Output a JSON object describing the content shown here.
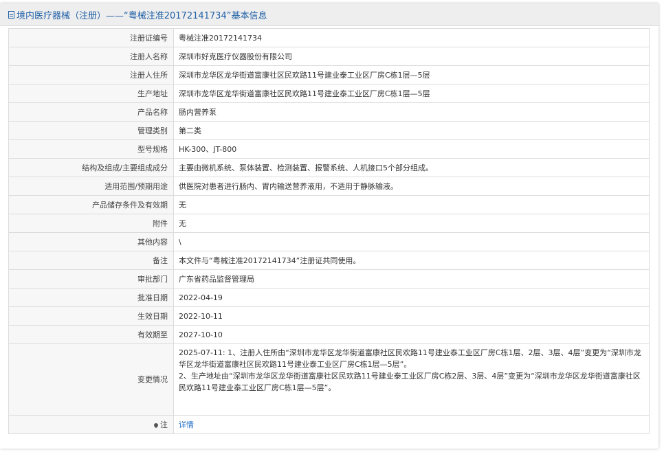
{
  "header": {
    "title": "境内医疗器械（注册）——“粤械注准20172141734”基本信息"
  },
  "rows": [
    {
      "label": "注册证编号",
      "value": "粤械注准20172141734"
    },
    {
      "label": "注册人名称",
      "value": "深圳市好克医疗仪器股份有限公司"
    },
    {
      "label": "注册人住所",
      "value": "深圳市龙华区龙华街道富康社区民欢路11号建业泰工业区厂房C栋1层—5层"
    },
    {
      "label": "生产地址",
      "value": "深圳市龙华区龙华街道富康社区民欢路11号建业泰工业区厂房C栋1层—5层"
    },
    {
      "label": "产品名称",
      "value": "肠内营养泵"
    },
    {
      "label": "管理类别",
      "value": "第二类"
    },
    {
      "label": "型号规格",
      "value": "HK-300、JT-800"
    },
    {
      "label": "结构及组成/主要组成成分",
      "value": "主要由微机系统、泵体装置、检测装置、报警系统、人机接口5个部分组成。"
    },
    {
      "label": "适用范围/预期用途",
      "value": "供医院对患者进行肠内、胃内输送营养液用，不适用于静脉输液。"
    },
    {
      "label": "产品储存条件及有效期",
      "value": "无"
    },
    {
      "label": "附件",
      "value": "无"
    },
    {
      "label": "其他内容",
      "value": "\\"
    },
    {
      "label": "备注",
      "value": "本文件与“粤械注准20172141734”注册证共同使用。"
    },
    {
      "label": "审批部门",
      "value": "广东省药品监督管理局"
    },
    {
      "label": "批准日期",
      "value": "2022-04-19"
    },
    {
      "label": "生效日期",
      "value": "2022-10-11"
    },
    {
      "label": "有效期至",
      "value": "2027-10-10"
    }
  ],
  "changes": {
    "label": "变更情况",
    "line1": "2025-07-11: 1、注册人住所由“深圳市龙华区龙华街道富康社区民欢路11号建业泰工业区厂房C栋1层、2层、3层、4层”变更为“深圳市龙华区龙华街道富康社区民欢路11号建业泰工业区厂房C栋1层—5层”。",
    "line2": "2、生产地址由“深圳市龙华区龙华街道富康社区民欢路11号建业泰工业区厂房C栋2层、3层、4层”变更为“深圳市龙华区龙华街道富康社区民欢路11号建业泰工业区厂房C栋1层—5层”。"
  },
  "note": {
    "label": "注",
    "link_text": "详情"
  },
  "icons": {
    "header": "document-icon",
    "note": "pin-icon"
  },
  "colors": {
    "title": "#1f5fa6",
    "link": "#1f6fc6"
  }
}
